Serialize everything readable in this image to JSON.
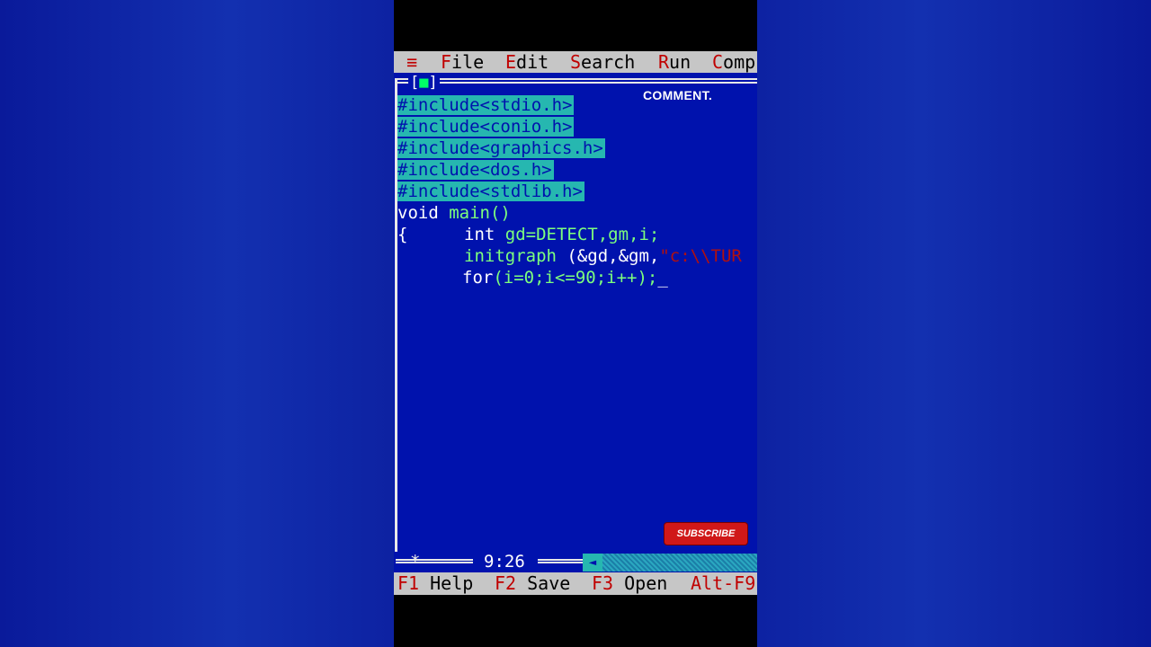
{
  "menu": {
    "system_glyph": "≡",
    "file": {
      "hot": "F",
      "rest": "ile"
    },
    "edit": {
      "hot": "E",
      "rest": "dit"
    },
    "search": {
      "hot": "S",
      "rest": "earch"
    },
    "run": {
      "hot": "R",
      "rest": "un"
    },
    "compile": {
      "hot": "C",
      "rest": "omp"
    }
  },
  "editor": {
    "close_left": "[",
    "close_mark": "■",
    "close_right": "]",
    "overlay_caption": "COMMENT.",
    "lines": {
      "l1": "#include<stdio.h>",
      "l2": "#include<conio.h>",
      "l3": "#include<graphics.h>",
      "l4": "#include<dos.h>",
      "l5": "#include<stdlib.h>",
      "l6_kw": "void ",
      "l6_fn": "main()",
      "l7_brace": "{",
      "l7_kw": "int ",
      "l7_rest": "gd=DETECT,gm,i;",
      "l8_fn": "initgraph ",
      "l8_rest": "(&gd,&gm,",
      "l8_str": "\"c:\\\\TUR",
      "l9_kw": "for",
      "l9_rest": "(i=0;i<=90;i++);",
      "cursor": "_"
    }
  },
  "overlay": {
    "subscribe_label": "SUBSCRIBE"
  },
  "status": {
    "marker": "*",
    "position": "9:26",
    "scroll_arrow": "◄"
  },
  "function_keys": {
    "f1_key": "F1",
    "f1_label": "Help",
    "f2_key": "F2",
    "f2_label": "Save",
    "f3_key": "F3",
    "f3_label": "Open",
    "alt_key": "Alt-F9"
  },
  "colors": {
    "editor_bg": "#0012ad",
    "selection_bg": "#26b7b0",
    "menu_bg": "#c6c6c6",
    "hotkey": "#c00000",
    "keyword_green": "#7dff7d",
    "string_red": "#b01010"
  }
}
